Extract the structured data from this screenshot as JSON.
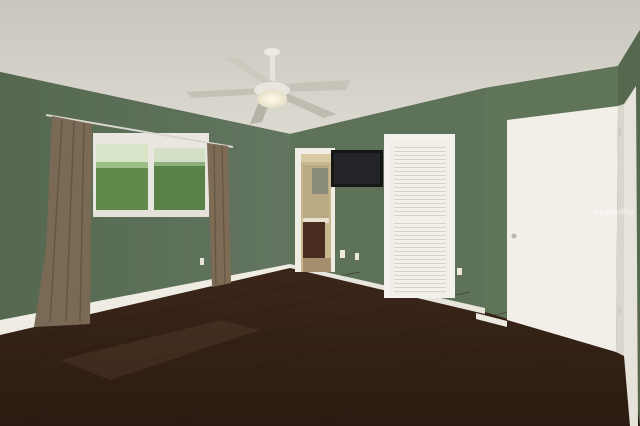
{
  "photo": {
    "subject": "empty-bedroom",
    "colors": {
      "wall": "#5c6e56",
      "wall_dark": "#4d5c47",
      "ceiling": "#d2d0c6",
      "floor": "#3a2518",
      "trim": "#efece4",
      "door": "#f1efe8",
      "curtain": "#7a6a55"
    }
  },
  "watermark": {
    "text": "RealtorPro"
  }
}
